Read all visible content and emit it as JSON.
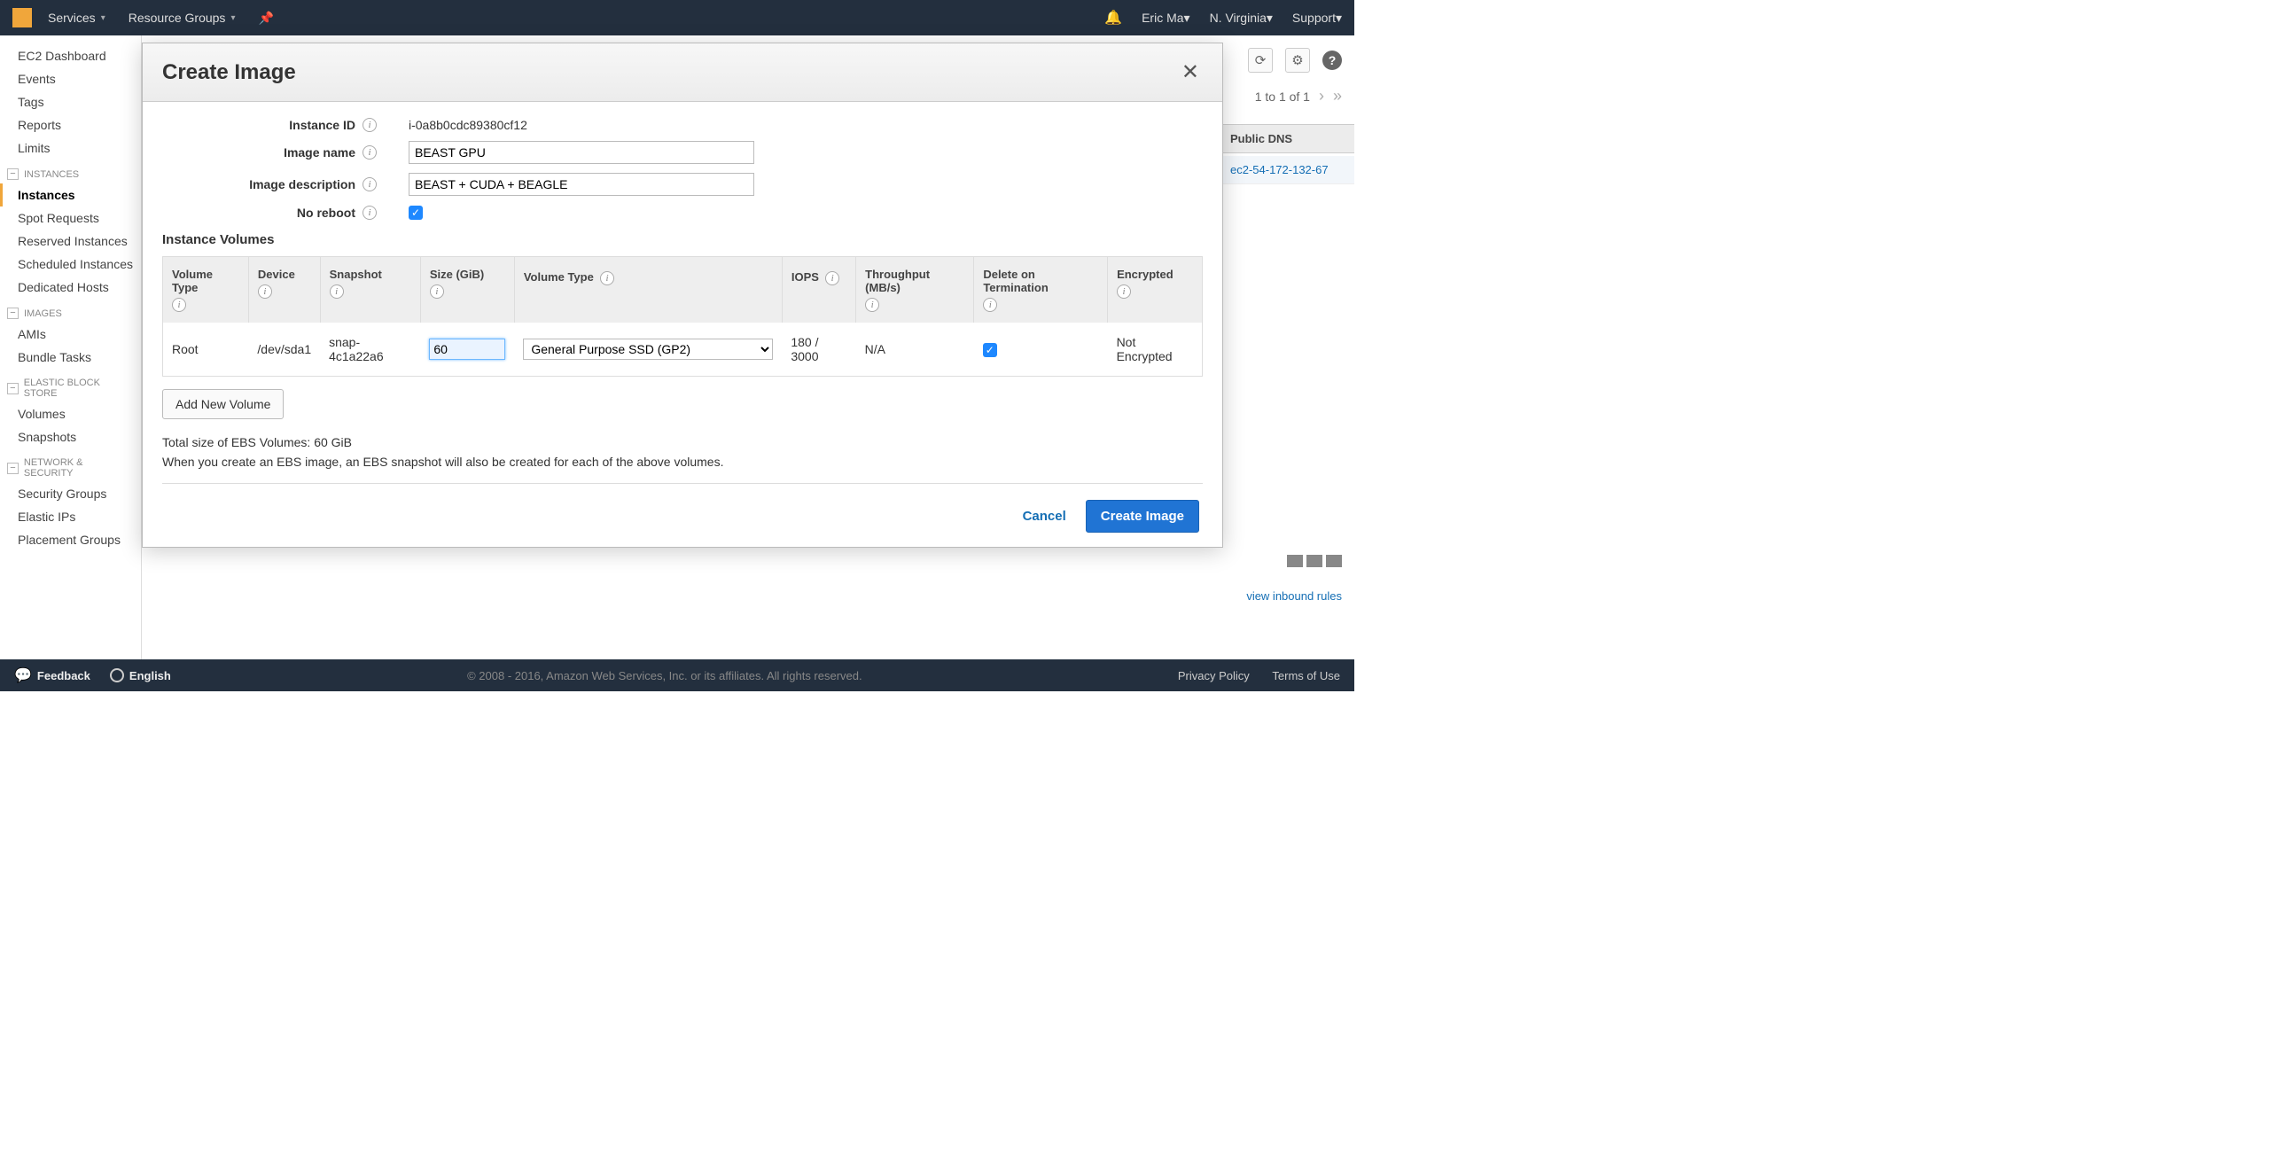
{
  "topnav": {
    "services": "Services",
    "resource_groups": "Resource Groups",
    "user": "Eric Ma",
    "region": "N. Virginia",
    "support": "Support"
  },
  "sidebar": {
    "dashboard": "EC2 Dashboard",
    "events": "Events",
    "tags": "Tags",
    "reports": "Reports",
    "limits": "Limits",
    "group_instances": "INSTANCES",
    "instances": "Instances",
    "spot": "Spot Requests",
    "reserved": "Reserved Instances",
    "scheduled": "Scheduled Instances",
    "dedicated": "Dedicated Hosts",
    "group_images": "IMAGES",
    "amis": "AMIs",
    "bundle": "Bundle Tasks",
    "group_ebs": "ELASTIC BLOCK STORE",
    "volumes": "Volumes",
    "snapshots": "Snapshots",
    "group_net": "NETWORK & SECURITY",
    "sg": "Security Groups",
    "eip": "Elastic IPs",
    "pg": "Placement Groups"
  },
  "pager": {
    "text": "1 to 1 of 1"
  },
  "table_peek": {
    "header": "Public DNS",
    "value": "ec2-54-172-132-67"
  },
  "inbound_peek": "view inbound rules",
  "modal": {
    "title": "Create Image",
    "labels": {
      "instance_id": "Instance ID",
      "image_name": "Image name",
      "image_description": "Image description",
      "no_reboot": "No reboot"
    },
    "values": {
      "instance_id": "i-0a8b0cdc89380cf12",
      "image_name": "BEAST GPU",
      "image_description": "BEAST + CUDA + BEAGLE",
      "no_reboot_checked": true
    },
    "instance_volumes_title": "Instance Volumes",
    "vol_headers": {
      "volume_type_left": "Volume Type",
      "device": "Device",
      "snapshot": "Snapshot",
      "size": "Size (GiB)",
      "volume_type_sel": "Volume Type",
      "iops": "IOPS",
      "throughput": "Throughput (MB/s)",
      "delete_on_term": "Delete on Termination",
      "encrypted": "Encrypted"
    },
    "vol_row": {
      "root": "Root",
      "device": "/dev/sda1",
      "snapshot": "snap-4c1a22a6",
      "size": "60",
      "volume_type_sel": "General Purpose SSD (GP2)",
      "iops": "180 / 3000",
      "throughput": "N/A",
      "delete_on_term_checked": true,
      "encrypted": "Not Encrypted"
    },
    "add_volume_btn": "Add New Volume",
    "total_note": "Total size of EBS Volumes: 60 GiB",
    "ebs_note": "When you create an EBS image, an EBS snapshot will also be created for each of the above volumes.",
    "cancel": "Cancel",
    "create": "Create Image"
  },
  "footer": {
    "feedback": "Feedback",
    "language": "English",
    "copyright": "© 2008 - 2016, Amazon Web Services, Inc. or its affiliates. All rights reserved.",
    "privacy": "Privacy Policy",
    "terms": "Terms of Use"
  }
}
